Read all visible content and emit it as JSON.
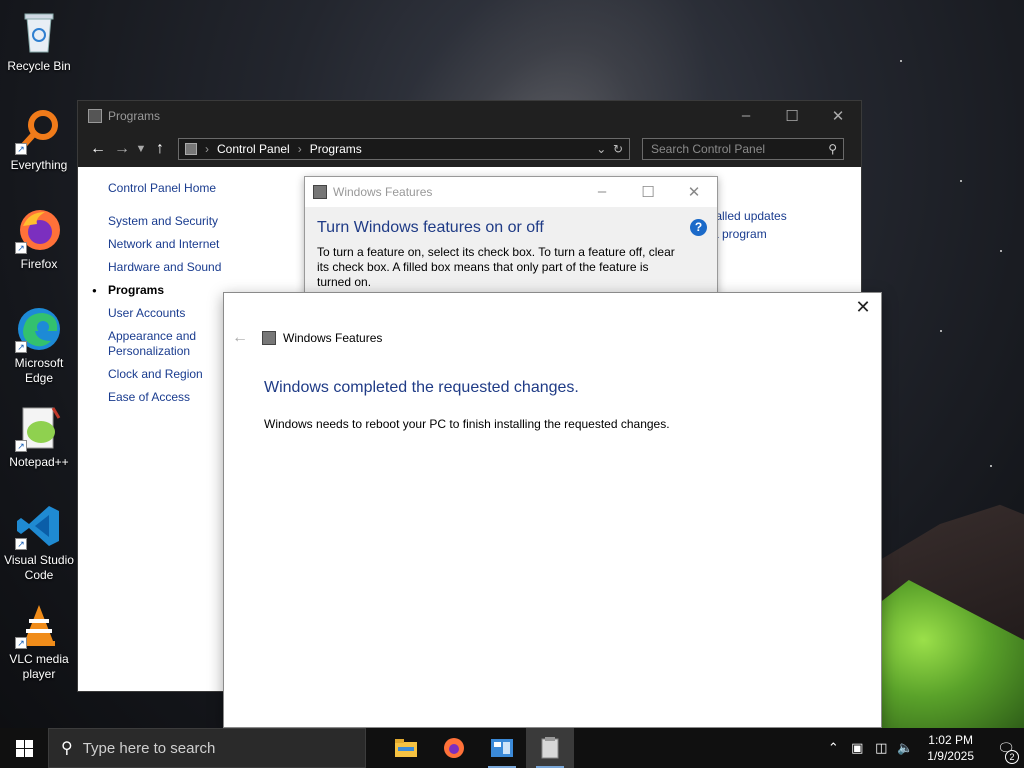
{
  "desktop": {
    "icons": [
      {
        "label": "Recycle Bin",
        "icon": "recycle-bin-icon"
      },
      {
        "label": "Everything",
        "icon": "everything-search-icon"
      },
      {
        "label": "Firefox",
        "icon": "firefox-icon"
      },
      {
        "label": "Microsoft Edge",
        "icon": "edge-icon"
      },
      {
        "label": "Notepad++",
        "icon": "notepad-plus-plus-icon"
      },
      {
        "label": "Visual Studio Code",
        "icon": "vscode-icon"
      },
      {
        "label": "VLC media player",
        "icon": "vlc-icon"
      }
    ]
  },
  "control_panel": {
    "title": "Programs",
    "breadcrumb": [
      "Control Panel",
      "Programs"
    ],
    "search_placeholder": "Search Control Panel",
    "sidebar": {
      "home": "Control Panel Home",
      "items": [
        "System and Security",
        "Network and Internet",
        "Hardware and Sound",
        "Programs",
        "User Accounts",
        "Appearance and Personalization",
        "Clock and Region",
        "Ease of Access"
      ],
      "active": "Programs"
    },
    "partial_links": [
      "talled updates",
      "a program"
    ]
  },
  "features_dialog": {
    "title": "Windows Features",
    "heading": "Turn Windows features on or off",
    "description": "To turn a feature on, select its check box. To turn a feature off, clear its check box. A filled box means that only part of the feature is turned on.",
    "help": "?"
  },
  "completion_dialog": {
    "nav_title": "Windows Features",
    "heading": "Windows completed the requested changes.",
    "message": "Windows needs to reboot your PC to finish installing the requested changes."
  },
  "taskbar": {
    "search_placeholder": "Type here to search",
    "apps": [
      "file-explorer-icon",
      "firefox-icon",
      "control-panel-icon",
      "windows-features-icon"
    ],
    "clock_time": "1:02 PM",
    "clock_date": "1/9/2025",
    "notification_count": "2"
  },
  "colors": {
    "link_blue": "#1a3c8f",
    "heading_blue": "#1f3b86",
    "taskbar": "#101010",
    "titlebar_dark": "#202020"
  }
}
